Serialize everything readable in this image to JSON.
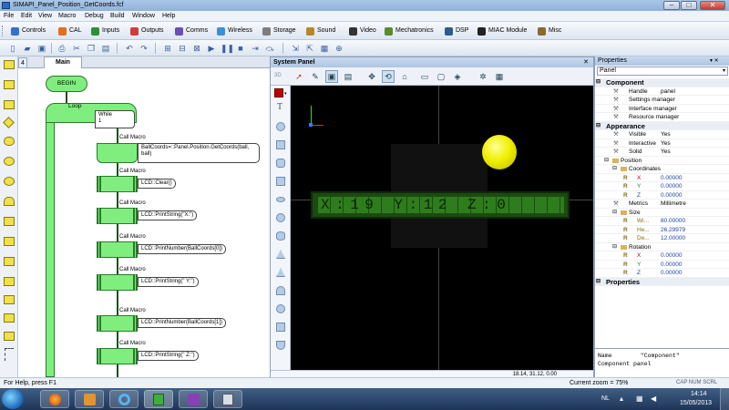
{
  "window": {
    "title": "SIMAPI_Panel_Position_GetCoords.fcf",
    "controls": {
      "minimize": "–",
      "maximize": "□",
      "close": "✕"
    }
  },
  "menu": [
    "File",
    "Edit",
    "View",
    "Macro",
    "Debug",
    "Build",
    "Window",
    "Help"
  ],
  "toolbar1": [
    {
      "label": "Controls",
      "color": "#3a6fc4"
    },
    {
      "label": "CAL",
      "color": "#e07020"
    },
    {
      "label": "Inputs",
      "color": "#2d8f3a"
    },
    {
      "label": "Outputs",
      "color": "#d23c3c"
    },
    {
      "label": "Comms",
      "color": "#6a4fb5"
    },
    {
      "label": "Wireless",
      "color": "#3d8fd0"
    },
    {
      "label": "Storage",
      "color": "#7d7d7d"
    },
    {
      "label": "Sound",
      "color": "#b8862a"
    },
    {
      "label": "Video",
      "color": "#333333"
    },
    {
      "label": "Mechatronics",
      "color": "#5b8a2f"
    },
    {
      "label": "DSP",
      "color": "#2d5c8a"
    },
    {
      "label": "MIAC Module",
      "color": "#222222"
    },
    {
      "label": "Misc",
      "color": "#8a6a2f"
    }
  ],
  "tabs": {
    "number": "4",
    "main": "Main"
  },
  "flowchart": {
    "begin": "BEGIN",
    "loop": "Loop",
    "while_label": "While",
    "while_cond": "1",
    "call_label": "Call Macro",
    "calls": [
      "BallCoords=::Panel.Position.GetCoords(ball, ball)",
      "LCD::Clear()",
      "LCD::PrintString(\"X:\")",
      "LCD::PrintNumber(BallCoords[0])",
      "LCD::PrintString(\" Y:\")",
      "LCD::PrintNumber(BallCoords[1])",
      "LCD::PrintString(\" Z:\")"
    ]
  },
  "system_panel": {
    "title": "System Panel",
    "lcd_text": "X:19 Y:12 Z:0",
    "coords": "18.14, 31.12, 0.00",
    "mode_label": "3D"
  },
  "properties": {
    "title": "Properties",
    "selected": "Panel",
    "rows": [
      {
        "type": "cat",
        "label": "Component",
        "indent": 0
      },
      {
        "type": "row",
        "label": "Handle",
        "value": "panel",
        "indent": 2,
        "icon": "wrench-icon"
      },
      {
        "type": "row",
        "label": "Settings manager",
        "value": "",
        "indent": 2,
        "icon": "wrench-icon"
      },
      {
        "type": "row",
        "label": "Interface manager",
        "value": "",
        "indent": 2,
        "icon": "wrench-icon"
      },
      {
        "type": "row",
        "label": "Resource manager",
        "value": "",
        "indent": 2,
        "icon": "wrench-icon"
      },
      {
        "type": "cat",
        "label": "Appearance",
        "indent": 0
      },
      {
        "type": "row",
        "label": "Visible",
        "value": "Yes",
        "indent": 2,
        "icon": "wrench-icon"
      },
      {
        "type": "row",
        "label": "Interactive",
        "value": "Yes",
        "indent": 2,
        "icon": "wrench-icon"
      },
      {
        "type": "row",
        "label": "Solid",
        "value": "Yes",
        "indent": 2,
        "icon": "wrench-icon"
      },
      {
        "type": "sub",
        "label": "Position",
        "value": "",
        "indent": 1
      },
      {
        "type": "sub",
        "label": "Coordinates",
        "value": "",
        "indent": 2
      },
      {
        "type": "coord",
        "label": "X",
        "value": "0.00000",
        "indent": 3
      },
      {
        "type": "coord",
        "label": "Y",
        "value": "0.00000",
        "indent": 3
      },
      {
        "type": "coord",
        "label": "Z",
        "value": "0.00000",
        "indent": 3
      },
      {
        "type": "row",
        "label": "Metrics",
        "value": "Millimetre",
        "indent": 2,
        "icon": "wrench-icon"
      },
      {
        "type": "sub",
        "label": "Size",
        "value": "",
        "indent": 2
      },
      {
        "type": "coord",
        "label": "Wi...",
        "value": "80.00000",
        "indent": 3
      },
      {
        "type": "coord",
        "label": "He...",
        "value": "26.29979",
        "indent": 3
      },
      {
        "type": "coord",
        "label": "De...",
        "value": "12.00000",
        "indent": 3
      },
      {
        "type": "sub",
        "label": "Rotation",
        "value": "",
        "indent": 2
      },
      {
        "type": "coord",
        "label": "X",
        "value": "0.00000",
        "indent": 3
      },
      {
        "type": "coord",
        "label": "Y",
        "value": "0.00000",
        "indent": 3
      },
      {
        "type": "coord",
        "label": "Z",
        "value": "0.00000",
        "indent": 3
      },
      {
        "type": "cat",
        "label": "Properties",
        "indent": 0
      }
    ],
    "desc_line1": "Name        \"Component\"",
    "desc_line2": "Component panel"
  },
  "statusbar": {
    "help": "For Help, press F1",
    "zoom": "Current zoom = 75%",
    "keys": "CAP  NUM  SCRL"
  },
  "taskbar": {
    "lang": "NL",
    "time": "14:14",
    "date": "15/05/2013"
  }
}
